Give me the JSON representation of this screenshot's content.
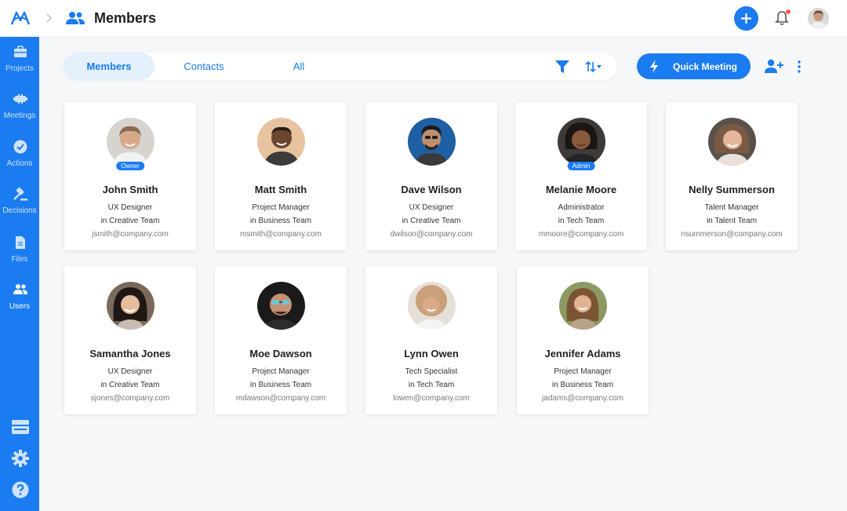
{
  "header": {
    "title": "Members"
  },
  "sidebar": {
    "items": [
      {
        "label": "Projects"
      },
      {
        "label": "Meetings"
      },
      {
        "label": "Actions"
      },
      {
        "label": "Decisions"
      },
      {
        "label": "Files"
      },
      {
        "label": "Users"
      }
    ]
  },
  "tabs": [
    {
      "label": "Members"
    },
    {
      "label": "Contacts"
    },
    {
      "label": "All"
    }
  ],
  "toolbar": {
    "quick_meeting_label": "Quick Meeting"
  },
  "members": [
    {
      "name": "John Smith",
      "role": "UX Designer",
      "team": "in Creative Team",
      "email": "jsmith@company.com",
      "badge": "Owner"
    },
    {
      "name": "Matt Smith",
      "role": "Project Manager",
      "team": "in Business Team",
      "email": "msmith@company.com",
      "badge": ""
    },
    {
      "name": "Dave Wilson",
      "role": "UX Designer",
      "team": "in Creative Team",
      "email": "dwilson@company.com",
      "badge": ""
    },
    {
      "name": "Melanie Moore",
      "role": "Administrator",
      "team": "in Tech Team",
      "email": "mmoore@company.com",
      "badge": "Admin"
    },
    {
      "name": "Nelly Summerson",
      "role": "Talent Manager",
      "team": "in Talent Team",
      "email": "nsummerson@company.com",
      "badge": ""
    },
    {
      "name": "Samantha Jones",
      "role": "UX Designer",
      "team": "in Creative Team",
      "email": "sjones@company.com",
      "badge": ""
    },
    {
      "name": "Moe Dawson",
      "role": "Project Manager",
      "team": "in Business Team",
      "email": "mdawson@company.com",
      "badge": ""
    },
    {
      "name": "Lynn Owen",
      "role": "Tech Specialist",
      "team": "in Tech Team",
      "email": "lowen@company.com",
      "badge": ""
    },
    {
      "name": "Jennifer Adams",
      "role": "Project Manager",
      "team": "in Business Team",
      "email": "jadams@company.com",
      "badge": ""
    }
  ],
  "colors": {
    "accent": "#1a7cf0",
    "notification_dot": "#ff5d4a",
    "background": "#f6f7f9"
  }
}
